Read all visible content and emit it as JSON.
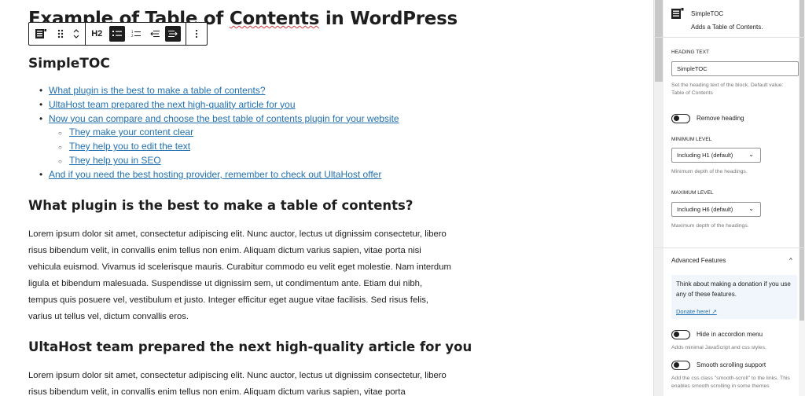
{
  "post": {
    "title_part1": "Example of Table of",
    "title_part2": "Contents",
    "title_part3": " in WordPress"
  },
  "toolbar": {
    "block_icon": "toc-block-icon",
    "drag": "⠿",
    "move": "⌃⌄",
    "heading_level": "H2",
    "list_unordered": "≔",
    "list_ordered": "⅟≡",
    "outdent": "⇤",
    "indent": "⇥",
    "more": "⋮"
  },
  "toc": {
    "heading": "SimpleTOC",
    "items": [
      {
        "text": "What plugin is the best to make a table of contents?",
        "sub": false
      },
      {
        "text": "UltaHost team prepared the next high-quality article for you",
        "sub": false
      },
      {
        "text": "Now you can compare and choose the best table of contents plugin for your website",
        "sub": false
      },
      {
        "text": "They make your content clear",
        "sub": true
      },
      {
        "text": "They help you to edit the text",
        "sub": true
      },
      {
        "text": "They help you in SEO",
        "sub": true
      },
      {
        "text": "And if you need the best hosting provider, remember to check out UltaHost offer",
        "sub": false
      }
    ]
  },
  "content": {
    "h2_1": "What plugin is the best to make a table of contents?",
    "p1": "Lorem ipsum dolor sit amet, consectetur adipiscing elit. Nunc auctor, lectus ut dignissim consectetur, libero risus bibendum velit, in convallis enim tellus non enim. Aliquam dictum varius sapien, vitae porta nisi vehicula euismod. Vivamus id scelerisque mauris. Curabitur commodo eu velit eget molestie. Nam interdum ligula et bibendum malesuada. Suspendisse ut dignissim sem, ut condimentum ante. Etiam dui nibh, tempus quis posuere vel, vestibulum et justo. Integer efficitur eget augue vitae facilisis. Sed risus felis, varius ut tellus vel, dictum convallis eros.",
    "h2_2": "UltaHost team prepared the next high-quality article for you",
    "p2": "Lorem ipsum dolor sit amet, consectetur adipiscing elit. Nunc auctor, lectus ut dignissim consectetur, libero risus bibendum velit, in convallis enim tellus non enim. Aliquam dictum varius sapien, vitae porta"
  },
  "sidebar": {
    "block_name": "SimpleTOC",
    "block_desc": "Adds a Table of Contents.",
    "heading_text_label": "HEADING TEXT",
    "heading_text_value": "SimpleTOC",
    "heading_text_help": "Set the heading text of the block. Default value: Table of Contents",
    "remove_heading": "Remove heading",
    "min_level_label": "MINIMUM LEVEL",
    "min_level_value": "Including H1 (default)",
    "min_level_help": "Minimum depth of the headings.",
    "max_level_label": "MAXIMUM LEVEL",
    "max_level_value": "Including H6 (default)",
    "max_level_help": "Maximum depth of the headings.",
    "advanced_title": "Advanced Features",
    "advanced_chevron": "^",
    "notice_text": "Think about making a donation if you use any of these features.",
    "donate_link": "Donate here! ↗",
    "hide_accordion": "Hide in accordion menu",
    "hide_accordion_help": "Adds minimal JavaScript and css styles.",
    "smooth_scroll": "Smooth scrolling support",
    "smooth_scroll_help": "Add the css class \"smooth-scroll\" to the links. This enables smooth scrolling in some themes"
  }
}
